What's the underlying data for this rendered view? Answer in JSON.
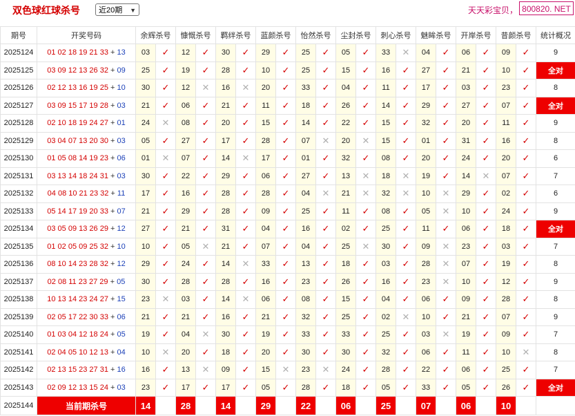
{
  "header": {
    "title": "双色球红球杀号",
    "period_select": "近20期",
    "slogan": "天天彩宝贝，",
    "site": "800820. NET"
  },
  "columns": [
    "期号",
    "开奖号码",
    "余辉杀号",
    "慷慨杀号",
    "羁绊杀号",
    "蓝颜杀号",
    "怡然杀号",
    "尘封杀号",
    "刺心杀号",
    "魅眸杀号",
    "开岸杀号",
    "昔颜杀号",
    "统计概况"
  ],
  "rows": [
    {
      "issue": "2025124",
      "red": "01 02 18 19 21 33",
      "blue": "13",
      "kills": [
        [
          "03",
          true
        ],
        [
          "12",
          true
        ],
        [
          "30",
          true
        ],
        [
          "29",
          true
        ],
        [
          "25",
          true
        ],
        [
          "05",
          true
        ],
        [
          "33",
          false
        ],
        [
          "04",
          true
        ],
        [
          "06",
          true
        ],
        [
          "09",
          true
        ]
      ],
      "stat": "9",
      "full": false
    },
    {
      "issue": "2025125",
      "red": "03 09 12 13 26 32",
      "blue": "09",
      "kills": [
        [
          "25",
          true
        ],
        [
          "19",
          true
        ],
        [
          "28",
          true
        ],
        [
          "10",
          true
        ],
        [
          "25",
          true
        ],
        [
          "15",
          true
        ],
        [
          "16",
          true
        ],
        [
          "27",
          true
        ],
        [
          "21",
          true
        ],
        [
          "10",
          true
        ]
      ],
      "stat": "全对",
      "full": true
    },
    {
      "issue": "2025126",
      "red": "02 12 13 16 19 25",
      "blue": "10",
      "kills": [
        [
          "30",
          true
        ],
        [
          "12",
          false
        ],
        [
          "16",
          false
        ],
        [
          "20",
          true
        ],
        [
          "33",
          true
        ],
        [
          "04",
          true
        ],
        [
          "11",
          true
        ],
        [
          "17",
          true
        ],
        [
          "03",
          true
        ],
        [
          "23",
          true
        ]
      ],
      "stat": "8",
      "full": false
    },
    {
      "issue": "2025127",
      "red": "03 09 15 17 19 28",
      "blue": "03",
      "kills": [
        [
          "21",
          true
        ],
        [
          "06",
          true
        ],
        [
          "21",
          true
        ],
        [
          "11",
          true
        ],
        [
          "18",
          true
        ],
        [
          "26",
          true
        ],
        [
          "14",
          true
        ],
        [
          "29",
          true
        ],
        [
          "27",
          true
        ],
        [
          "07",
          true
        ]
      ],
      "stat": "全对",
      "full": true
    },
    {
      "issue": "2025128",
      "red": "02 10 18 19 24 27",
      "blue": "01",
      "kills": [
        [
          "24",
          false
        ],
        [
          "08",
          true
        ],
        [
          "20",
          true
        ],
        [
          "15",
          true
        ],
        [
          "14",
          true
        ],
        [
          "22",
          true
        ],
        [
          "15",
          true
        ],
        [
          "32",
          true
        ],
        [
          "20",
          true
        ],
        [
          "11",
          true
        ]
      ],
      "stat": "9",
      "full": false
    },
    {
      "issue": "2025129",
      "red": "03 04 07 13 20 30",
      "blue": "03",
      "kills": [
        [
          "05",
          true
        ],
        [
          "27",
          true
        ],
        [
          "17",
          true
        ],
        [
          "28",
          true
        ],
        [
          "07",
          false
        ],
        [
          "20",
          false
        ],
        [
          "15",
          true
        ],
        [
          "01",
          true
        ],
        [
          "31",
          true
        ],
        [
          "16",
          true
        ]
      ],
      "stat": "8",
      "full": false
    },
    {
      "issue": "2025130",
      "red": "01 05 08 14 19 23",
      "blue": "06",
      "kills": [
        [
          "01",
          false
        ],
        [
          "07",
          true
        ],
        [
          "14",
          false
        ],
        [
          "17",
          true
        ],
        [
          "01",
          true
        ],
        [
          "32",
          true
        ],
        [
          "08",
          true
        ],
        [
          "20",
          true
        ],
        [
          "24",
          true
        ],
        [
          "20",
          true
        ]
      ],
      "stat": "6",
      "full": false
    },
    {
      "issue": "2025131",
      "red": "03 13 14 18 24 31",
      "blue": "03",
      "kills": [
        [
          "30",
          true
        ],
        [
          "22",
          true
        ],
        [
          "29",
          true
        ],
        [
          "06",
          true
        ],
        [
          "27",
          true
        ],
        [
          "13",
          false
        ],
        [
          "18",
          false
        ],
        [
          "19",
          true
        ],
        [
          "14",
          false
        ],
        [
          "07",
          true
        ]
      ],
      "stat": "7",
      "full": false
    },
    {
      "issue": "2025132",
      "red": "04 08 10 21 23 32",
      "blue": "11",
      "kills": [
        [
          "17",
          true
        ],
        [
          "16",
          true
        ],
        [
          "28",
          true
        ],
        [
          "28",
          true
        ],
        [
          "04",
          false
        ],
        [
          "21",
          false
        ],
        [
          "32",
          false
        ],
        [
          "10",
          false
        ],
        [
          "29",
          true
        ],
        [
          "02",
          true
        ]
      ],
      "stat": "6",
      "full": false
    },
    {
      "issue": "2025133",
      "red": "05 14 17 19 20 33",
      "blue": "07",
      "kills": [
        [
          "21",
          true
        ],
        [
          "29",
          true
        ],
        [
          "28",
          true
        ],
        [
          "09",
          true
        ],
        [
          "25",
          true
        ],
        [
          "11",
          true
        ],
        [
          "08",
          true
        ],
        [
          "05",
          false
        ],
        [
          "10",
          true
        ],
        [
          "24",
          true
        ]
      ],
      "stat": "9",
      "full": false
    },
    {
      "issue": "2025134",
      "red": "03 05 09 13 26 29",
      "blue": "12",
      "kills": [
        [
          "27",
          true
        ],
        [
          "21",
          true
        ],
        [
          "31",
          true
        ],
        [
          "04",
          true
        ],
        [
          "16",
          true
        ],
        [
          "02",
          true
        ],
        [
          "25",
          true
        ],
        [
          "11",
          true
        ],
        [
          "06",
          true
        ],
        [
          "18",
          true
        ]
      ],
      "stat": "全对",
      "full": true
    },
    {
      "issue": "2025135",
      "red": "01 02 05 09 25 32",
      "blue": "10",
      "kills": [
        [
          "10",
          true
        ],
        [
          "05",
          false
        ],
        [
          "21",
          true
        ],
        [
          "07",
          true
        ],
        [
          "04",
          true
        ],
        [
          "25",
          false
        ],
        [
          "30",
          true
        ],
        [
          "09",
          false
        ],
        [
          "23",
          true
        ],
        [
          "03",
          true
        ]
      ],
      "stat": "7",
      "full": false
    },
    {
      "issue": "2025136",
      "red": "08 10 14 23 28 32",
      "blue": "12",
      "kills": [
        [
          "29",
          true
        ],
        [
          "24",
          true
        ],
        [
          "14",
          false
        ],
        [
          "33",
          true
        ],
        [
          "13",
          true
        ],
        [
          "18",
          true
        ],
        [
          "03",
          true
        ],
        [
          "28",
          false
        ],
        [
          "07",
          true
        ],
        [
          "19",
          true
        ]
      ],
      "stat": "8",
      "full": false
    },
    {
      "issue": "2025137",
      "red": "02 08 11 23 27 29",
      "blue": "05",
      "kills": [
        [
          "30",
          true
        ],
        [
          "28",
          true
        ],
        [
          "28",
          true
        ],
        [
          "16",
          true
        ],
        [
          "23",
          true
        ],
        [
          "26",
          true
        ],
        [
          "16",
          true
        ],
        [
          "23",
          false
        ],
        [
          "10",
          true
        ],
        [
          "12",
          true
        ]
      ],
      "stat": "9",
      "full": false
    },
    {
      "issue": "2025138",
      "red": "10 13 14 23 24 27",
      "blue": "15",
      "kills": [
        [
          "23",
          false
        ],
        [
          "03",
          true
        ],
        [
          "14",
          false
        ],
        [
          "06",
          true
        ],
        [
          "08",
          true
        ],
        [
          "15",
          true
        ],
        [
          "04",
          true
        ],
        [
          "06",
          true
        ],
        [
          "09",
          true
        ],
        [
          "28",
          true
        ]
      ],
      "stat": "8",
      "full": false
    },
    {
      "issue": "2025139",
      "red": "02 05 17 22 30 33",
      "blue": "06",
      "kills": [
        [
          "21",
          true
        ],
        [
          "21",
          true
        ],
        [
          "16",
          true
        ],
        [
          "21",
          true
        ],
        [
          "32",
          true
        ],
        [
          "25",
          true
        ],
        [
          "02",
          false
        ],
        [
          "10",
          true
        ],
        [
          "21",
          true
        ],
        [
          "07",
          true
        ]
      ],
      "stat": "9",
      "full": false
    },
    {
      "issue": "2025140",
      "red": "01 03 04 12 18 24",
      "blue": "05",
      "kills": [
        [
          "19",
          true
        ],
        [
          "04",
          false
        ],
        [
          "30",
          true
        ],
        [
          "19",
          true
        ],
        [
          "33",
          true
        ],
        [
          "33",
          true
        ],
        [
          "25",
          true
        ],
        [
          "03",
          false
        ],
        [
          "19",
          true
        ],
        [
          "09",
          true
        ]
      ],
      "stat": "7",
      "full": false
    },
    {
      "issue": "2025141",
      "red": "02 04 05 10 12 13",
      "blue": "04",
      "kills": [
        [
          "10",
          false
        ],
        [
          "20",
          true
        ],
        [
          "18",
          true
        ],
        [
          "20",
          true
        ],
        [
          "30",
          true
        ],
        [
          "30",
          true
        ],
        [
          "32",
          true
        ],
        [
          "06",
          true
        ],
        [
          "11",
          true
        ],
        [
          "10",
          false
        ]
      ],
      "stat": "8",
      "full": false
    },
    {
      "issue": "2025142",
      "red": "02 13 15 23 27 31",
      "blue": "16",
      "kills": [
        [
          "16",
          true
        ],
        [
          "13",
          false
        ],
        [
          "09",
          true
        ],
        [
          "15",
          false
        ],
        [
          "23",
          false
        ],
        [
          "24",
          true
        ],
        [
          "28",
          true
        ],
        [
          "22",
          true
        ],
        [
          "06",
          true
        ],
        [
          "25",
          true
        ]
      ],
      "stat": "7",
      "full": false
    },
    {
      "issue": "2025143",
      "red": "02 09 12 13 15 24",
      "blue": "03",
      "kills": [
        [
          "23",
          true
        ],
        [
          "17",
          true
        ],
        [
          "17",
          true
        ],
        [
          "05",
          true
        ],
        [
          "28",
          true
        ],
        [
          "18",
          true
        ],
        [
          "05",
          true
        ],
        [
          "33",
          true
        ],
        [
          "05",
          true
        ],
        [
          "26",
          true
        ]
      ],
      "stat": "全对",
      "full": true
    }
  ],
  "current": {
    "issue": "2025144",
    "label": "当前期杀号",
    "kills": [
      "14",
      "28",
      "14",
      "29",
      "22",
      "06",
      "25",
      "07",
      "06",
      "10"
    ]
  },
  "marks": {
    "ok": "✓",
    "no": "✕"
  },
  "colors": {
    "brand_red": "#d40000",
    "blue_ball": "#1a3fb8",
    "kill_bg": "#fffde6",
    "full_bg": "#ee0000"
  }
}
